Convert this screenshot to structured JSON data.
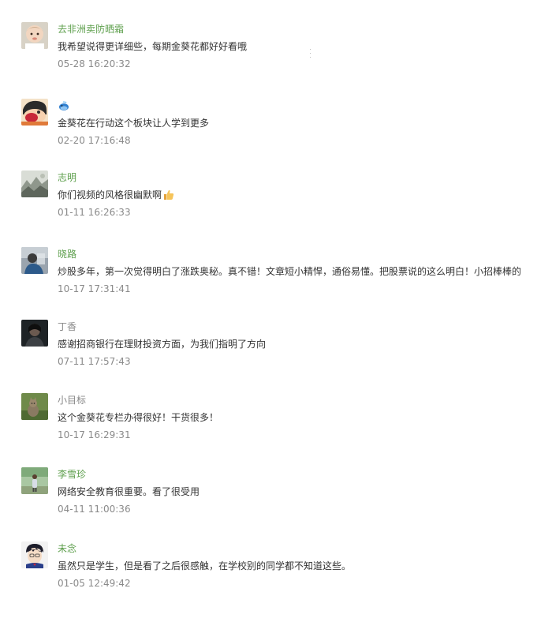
{
  "comments": [
    {
      "nickname": "去非洲卖防晒霜",
      "text": "我希望说得更详细些，每期金葵花都好好看哦",
      "time": "05-28 16:20:32",
      "avatar_icon": "baby-photo-avatar-icon"
    },
    {
      "nickname": "",
      "nickname_icon": "blue-whale-emoji-icon",
      "text": "金葵花在行动这个板块让人学到更多",
      "time": "02-20 17:16:48",
      "avatar_icon": "cartoon-character-avatar-icon"
    },
    {
      "nickname": "志明",
      "text": "你们视频的风格很幽默啊",
      "text_icon": "thumbs-up-emoji-icon",
      "time": "01-11 16:26:33",
      "avatar_icon": "landscape-painting-avatar-icon"
    },
    {
      "nickname": "晓路",
      "text": "炒股多年，第一次觉得明白了涨跌奥秘。真不错！文章短小精悍，通俗易懂。把股票说的这么明白！小招棒棒的",
      "time": "10-17 17:31:41",
      "avatar_icon": "person-photo-avatar-icon"
    },
    {
      "nickname": "丁香",
      "text": "感谢招商银行在理财投资方面，为我们指明了方向",
      "time": "07-11 17:57:43",
      "avatar_icon": "dark-portrait-avatar-icon"
    },
    {
      "nickname": "小目标",
      "text": "这个金葵花专栏办得很好！干货很多！",
      "time": "10-17 16:29:31",
      "avatar_icon": "cat-photo-avatar-icon"
    },
    {
      "nickname": "李雪珍",
      "text": "网络安全教育很重要。看了很受用",
      "time": "04-11 11:00:36",
      "avatar_icon": "outdoor-person-avatar-icon"
    },
    {
      "nickname": "未念",
      "text": "虽然只是学生，但是看了之后很感触，在学校别的同学都不知道这些。",
      "time": "01-05 12:49:42",
      "avatar_icon": "anime-boy-avatar-icon"
    }
  ],
  "colors": {
    "nickname_green": "#5fa04e",
    "nickname_gray": "#888888",
    "text": "#333333",
    "time": "#8a8a8a"
  }
}
